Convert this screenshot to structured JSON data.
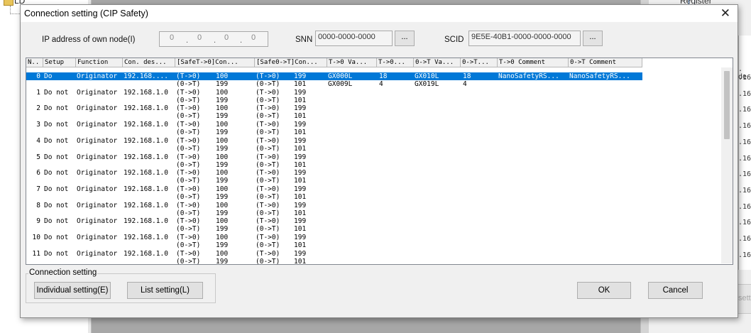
{
  "background": {
    "tree_label": "LD",
    "register_label": "Register",
    "panel_header": ". de",
    "panel_values": [
      ".16",
      ".16",
      ".16",
      ".16",
      ".16",
      ".16",
      ".16",
      ".16",
      ".16",
      ".16",
      ".16",
      ".16"
    ],
    "right_button": "setti"
  },
  "dialog": {
    "title": "Connection setting (CIP Safety)",
    "ip_label": "IP address of own node(I)",
    "ip_octets": [
      "0",
      "0",
      "0",
      "0"
    ],
    "snn_label": "SNN",
    "snn_value": "0000-0000-0000",
    "snn_button": "...",
    "scid_label": "SCID",
    "scid_value": "9E5E-40B1-0000-0000-0000",
    "scid_button": "..."
  },
  "table": {
    "columns": [
      "N..",
      "Setup",
      "Function",
      "Con. des...",
      "[SafeT->0]Con...",
      "[Safe0->T]Con...",
      "T->0 Va...",
      "T->0...",
      "0->T Va...",
      "0->T...",
      "T->0 Comment",
      "0->T Comment"
    ],
    "rows": [
      {
        "line1": [
          "0",
          "Do",
          "Originator",
          "192.168....",
          "(T->0)",
          "100",
          "(T->0)",
          "199",
          "GX000L",
          "18",
          "GX010L",
          "18",
          "NanoSafetyRS...",
          "NanoSafetyRS..."
        ],
        "line2": [
          "",
          "",
          "",
          "",
          "(0->T)",
          "199",
          "(0->T)",
          "101",
          "GX009L",
          "4",
          "GX019L",
          "4",
          "",
          ""
        ]
      },
      {
        "line1": [
          "1",
          "Do not",
          "Originator",
          "192.168.1.0",
          "(T->0)",
          "100",
          "(T->0)",
          "199",
          "",
          "",
          "",
          "",
          "",
          ""
        ],
        "line2": [
          "",
          "",
          "",
          "",
          "(0->T)",
          "199",
          "(0->T)",
          "101",
          "",
          "",
          "",
          "",
          "",
          ""
        ]
      },
      {
        "line1": [
          "2",
          "Do not",
          "Originator",
          "192.168.1.0",
          "(T->0)",
          "100",
          "(T->0)",
          "199",
          "",
          "",
          "",
          "",
          "",
          ""
        ],
        "line2": [
          "",
          "",
          "",
          "",
          "(0->T)",
          "199",
          "(0->T)",
          "101",
          "",
          "",
          "",
          "",
          "",
          ""
        ]
      },
      {
        "line1": [
          "3",
          "Do not",
          "Originator",
          "192.168.1.0",
          "(T->0)",
          "100",
          "(T->0)",
          "199",
          "",
          "",
          "",
          "",
          "",
          ""
        ],
        "line2": [
          "",
          "",
          "",
          "",
          "(0->T)",
          "199",
          "(0->T)",
          "101",
          "",
          "",
          "",
          "",
          "",
          ""
        ]
      },
      {
        "line1": [
          "4",
          "Do not",
          "Originator",
          "192.168.1.0",
          "(T->0)",
          "100",
          "(T->0)",
          "199",
          "",
          "",
          "",
          "",
          "",
          ""
        ],
        "line2": [
          "",
          "",
          "",
          "",
          "(0->T)",
          "199",
          "(0->T)",
          "101",
          "",
          "",
          "",
          "",
          "",
          ""
        ]
      },
      {
        "line1": [
          "5",
          "Do not",
          "Originator",
          "192.168.1.0",
          "(T->0)",
          "100",
          "(T->0)",
          "199",
          "",
          "",
          "",
          "",
          "",
          ""
        ],
        "line2": [
          "",
          "",
          "",
          "",
          "(0->T)",
          "199",
          "(0->T)",
          "101",
          "",
          "",
          "",
          "",
          "",
          ""
        ]
      },
      {
        "line1": [
          "6",
          "Do not",
          "Originator",
          "192.168.1.0",
          "(T->0)",
          "100",
          "(T->0)",
          "199",
          "",
          "",
          "",
          "",
          "",
          ""
        ],
        "line2": [
          "",
          "",
          "",
          "",
          "(0->T)",
          "199",
          "(0->T)",
          "101",
          "",
          "",
          "",
          "",
          "",
          ""
        ]
      },
      {
        "line1": [
          "7",
          "Do not",
          "Originator",
          "192.168.1.0",
          "(T->0)",
          "100",
          "(T->0)",
          "199",
          "",
          "",
          "",
          "",
          "",
          ""
        ],
        "line2": [
          "",
          "",
          "",
          "",
          "(0->T)",
          "199",
          "(0->T)",
          "101",
          "",
          "",
          "",
          "",
          "",
          ""
        ]
      },
      {
        "line1": [
          "8",
          "Do not",
          "Originator",
          "192.168.1.0",
          "(T->0)",
          "100",
          "(T->0)",
          "199",
          "",
          "",
          "",
          "",
          "",
          ""
        ],
        "line2": [
          "",
          "",
          "",
          "",
          "(0->T)",
          "199",
          "(0->T)",
          "101",
          "",
          "",
          "",
          "",
          "",
          ""
        ]
      },
      {
        "line1": [
          "9",
          "Do not",
          "Originator",
          "192.168.1.0",
          "(T->0)",
          "100",
          "(T->0)",
          "199",
          "",
          "",
          "",
          "",
          "",
          ""
        ],
        "line2": [
          "",
          "",
          "",
          "",
          "(0->T)",
          "199",
          "(0->T)",
          "101",
          "",
          "",
          "",
          "",
          "",
          ""
        ]
      },
      {
        "line1": [
          "10",
          "Do not",
          "Originator",
          "192.168.1.0",
          "(T->0)",
          "100",
          "(T->0)",
          "199",
          "",
          "",
          "",
          "",
          "",
          ""
        ],
        "line2": [
          "",
          "",
          "",
          "",
          "(0->T)",
          "199",
          "(0->T)",
          "101",
          "",
          "",
          "",
          "",
          "",
          ""
        ]
      },
      {
        "line1": [
          "11",
          "Do not",
          "Originator",
          "192.168.1.0",
          "(T->0)",
          "100",
          "(T->0)",
          "199",
          "",
          "",
          "",
          "",
          "",
          ""
        ],
        "line2": [
          "",
          "",
          "",
          "",
          "(0->T)",
          "199",
          "(0->T)",
          "101",
          "",
          "",
          "",
          "",
          "",
          ""
        ]
      }
    ]
  },
  "connection_setting": {
    "group_label": "Connection setting",
    "individual_button": "Individual setting(E)",
    "list_button": "List setting(L)"
  },
  "buttons": {
    "ok": "OK",
    "cancel": "Cancel"
  },
  "colors": {
    "selection": "#0078d7",
    "dialog_bg": "#f0f0f0"
  }
}
